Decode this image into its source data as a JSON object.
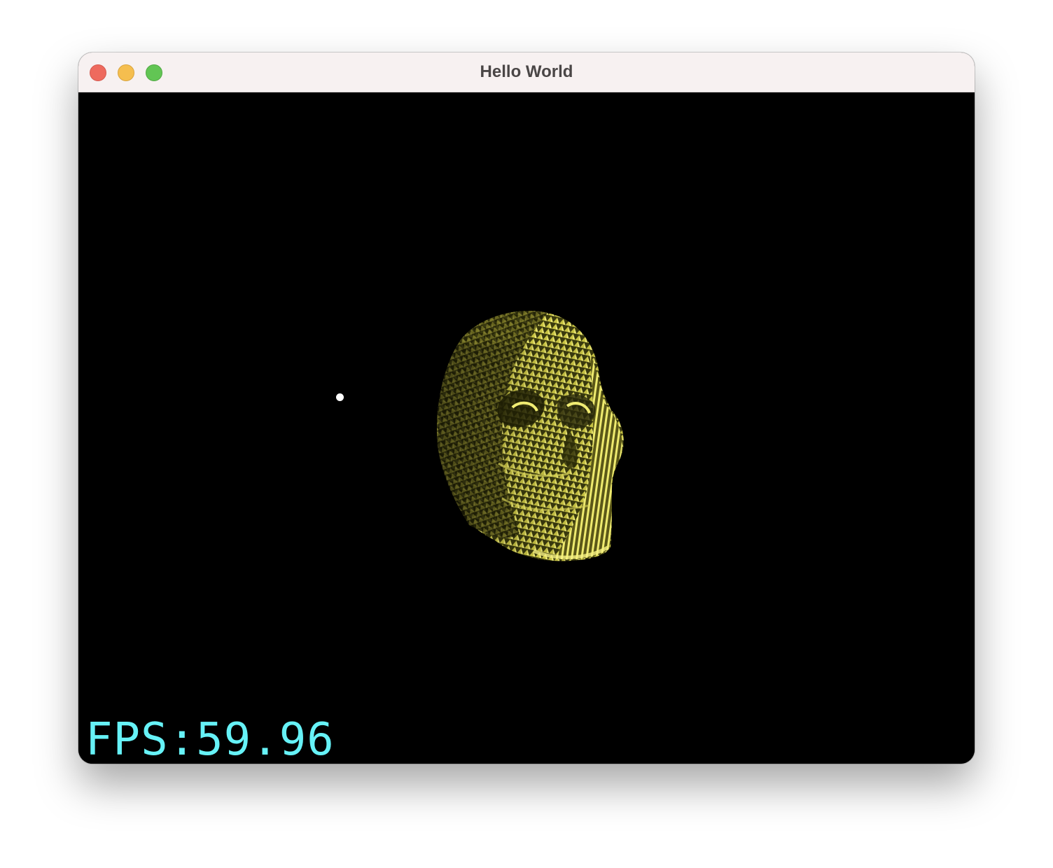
{
  "window": {
    "title": "Hello World"
  },
  "viewport": {
    "background": "#000000",
    "model_color": "#e6e25a",
    "model_icon": "wireframe-skull-3d-model",
    "light_color": "#ffffff"
  },
  "hud": {
    "fps_text": "FPS:59.96"
  }
}
